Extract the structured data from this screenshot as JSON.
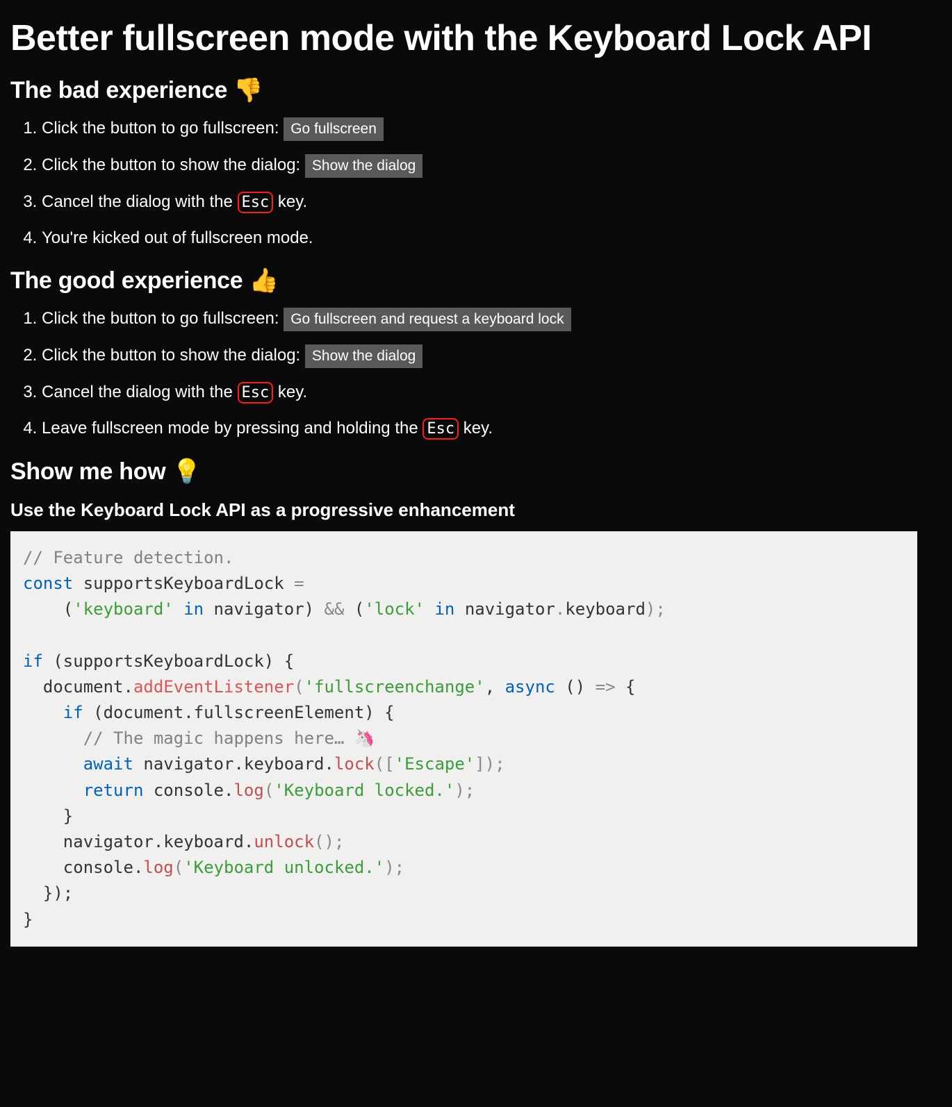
{
  "title": "Better fullscreen mode with the Keyboard Lock API",
  "bad": {
    "heading": "The bad experience 👎",
    "step1_text": "Click the button to go fullscreen: ",
    "step1_button": "Go fullscreen",
    "step2_text": "Click the button to show the dialog: ",
    "step2_button": "Show the dialog",
    "step3_pre": "Cancel the dialog with the ",
    "step3_kbd": "Esc",
    "step3_post": " key.",
    "step4": "You're kicked out of fullscreen mode."
  },
  "good": {
    "heading": "The good experience 👍",
    "step1_text": "Click the button to go fullscreen: ",
    "step1_button": "Go fullscreen and request a keyboard lock",
    "step2_text": "Click the button to show the dialog: ",
    "step2_button": "Show the dialog",
    "step3_pre": "Cancel the dialog with the ",
    "step3_kbd": "Esc",
    "step3_post": " key.",
    "step4_pre": "Leave fullscreen mode by pressing and holding the ",
    "step4_kbd": "Esc",
    "step4_post": " key."
  },
  "how": {
    "heading": "Show me how 💡",
    "subheading": "Use the Keyboard Lock API as a progressive enhancement"
  },
  "code": {
    "c1": "// Feature detection.",
    "kw_const": "const",
    "id_supports": " supportsKeyboardLock ",
    "eq": "=",
    "l2_a": "    (",
    "str_keyboard": "'keyboard'",
    "kw_in1": " in ",
    "id_nav1": "navigator",
    "l2_b": ") ",
    "op_and": "&&",
    "l2_c": " (",
    "str_lock": "'lock'",
    "kw_in2": " in ",
    "id_nav2": "navigator",
    "dot": ".",
    "id_kb": "keyboard",
    "l2_d": ");",
    "kw_if": "if",
    "l4_a": " (supportsKeyboardLock) {",
    "l5_a": "  document.",
    "m_ael": "addEventListener",
    "l5_b": "(",
    "str_fsc": "'fullscreenchange'",
    "l5_c": ", ",
    "kw_async": "async",
    "l5_d": " () ",
    "op_arrow": "=>",
    "l5_e": " {",
    "l6_a": "    ",
    "kw_if2": "if",
    "l6_b": " (document.fullscreenElement) {",
    "l7_a": "      ",
    "c2": "// The magic happens here… 🦄",
    "l8_a": "      ",
    "kw_await": "await",
    "l8_b": " navigator.keyboard.",
    "m_lock": "lock",
    "l8_c": "([",
    "str_esc": "'Escape'",
    "l8_d": "]);",
    "l9_a": "      ",
    "kw_return": "return",
    "l9_b": " console.",
    "m_log1": "log",
    "l9_c": "(",
    "str_locked": "'Keyboard locked.'",
    "l9_d": ");",
    "l10": "    }",
    "l11_a": "    navigator.keyboard.",
    "m_unlock": "unlock",
    "l11_b": "();",
    "l12_a": "    console.",
    "m_log2": "log",
    "l12_b": "(",
    "str_unlocked": "'Keyboard unlocked.'",
    "l12_c": ");",
    "l13": "  });",
    "l14": "}"
  }
}
